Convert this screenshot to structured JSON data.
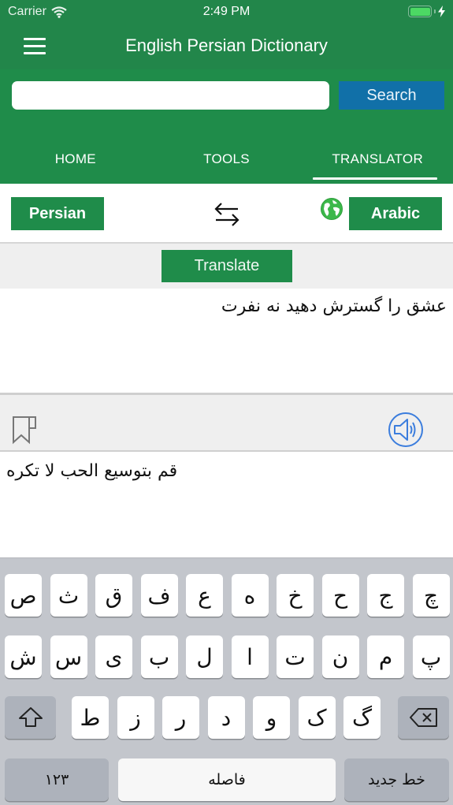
{
  "status_bar": {
    "carrier": "Carrier",
    "time": "2:49 PM",
    "battery_level": 1.0,
    "charging": true
  },
  "nav": {
    "title": "English Persian Dictionary",
    "menu_icon": "hamburger-menu-icon"
  },
  "search": {
    "value": "",
    "placeholder": "",
    "button_label": "Search"
  },
  "tabs": [
    {
      "label": "HOME",
      "active": false
    },
    {
      "label": "TOOLS",
      "active": false
    },
    {
      "label": "TRANSLATOR",
      "active": true
    }
  ],
  "translator": {
    "source_language": "Persian",
    "target_language": "Arabic",
    "swap_icon": "swap-arrows-icon",
    "globe_icon": "globe-icon",
    "translate_label": "Translate",
    "source_text": "عشق را گسترش دهید نه نفرت",
    "result_text": "قم بتوسيع الحب لا تكره",
    "bookmark_icon": "bookmark-icon",
    "speaker_icon": "speaker-icon"
  },
  "keyboard": {
    "row1": [
      "ص",
      "ث",
      "ق",
      "ف",
      "ع",
      "ه",
      "خ",
      "ح",
      "ج",
      "چ"
    ],
    "row2": [
      "ش",
      "س",
      "ی",
      "ب",
      "ل",
      "ا",
      "ت",
      "ن",
      "م",
      "پ"
    ],
    "row3": [
      "ط",
      "ز",
      "ر",
      "د",
      "و",
      "ک",
      "گ"
    ],
    "numbers_label": "۱۲۳",
    "space_label": "فاصله",
    "return_label": "خط جدید",
    "shift_icon": "shift-icon",
    "backspace_icon": "backspace-icon"
  },
  "colors": {
    "primary_green": "#1f8c4a",
    "search_blue": "#1170a8",
    "speaker_blue": "#3b7ddd",
    "globe_green": "#3cb84a"
  }
}
